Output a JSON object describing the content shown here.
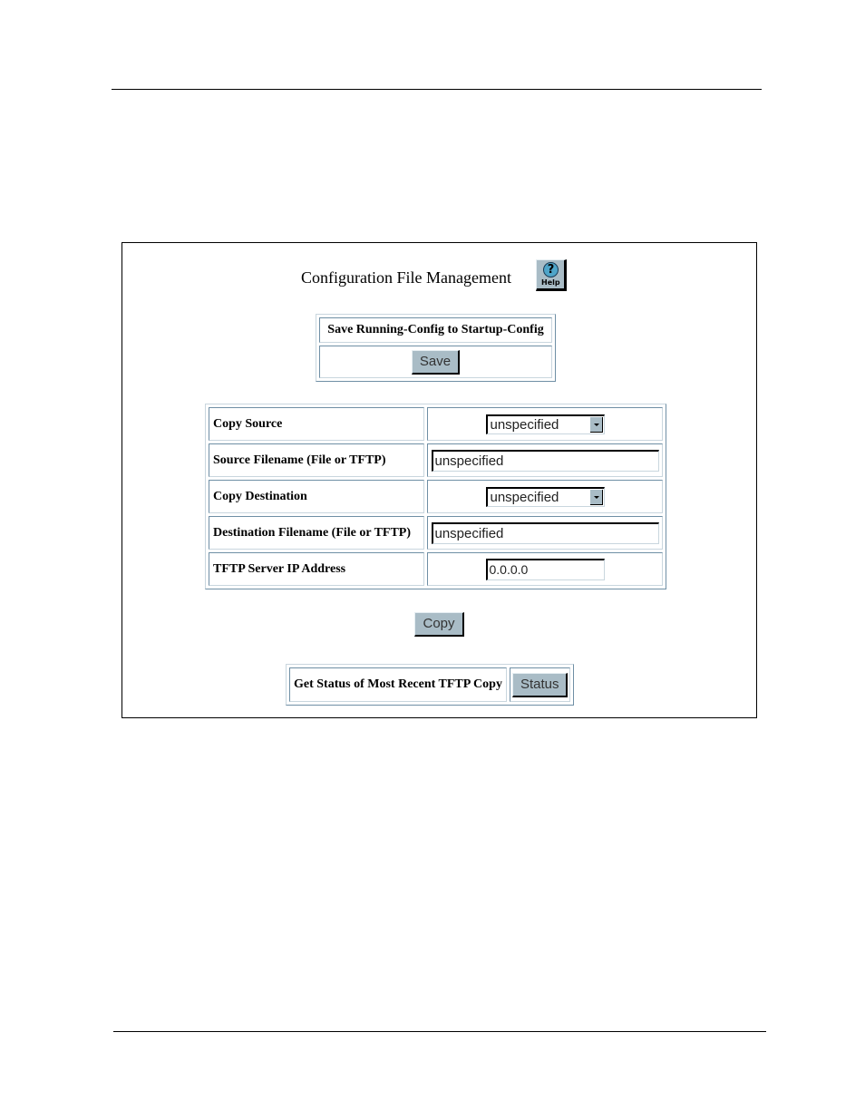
{
  "page": {
    "title": "Configuration File Management",
    "help_button": {
      "label": "Help",
      "icon": "help-question-icon"
    }
  },
  "save_section": {
    "header": "Save Running-Config to Startup-Config",
    "save_label": "Save"
  },
  "form": {
    "rows": [
      {
        "label": "Copy Source",
        "type": "select",
        "value": "unspecified"
      },
      {
        "label": "Source Filename (File or TFTP)",
        "type": "text",
        "value": "unspecified"
      },
      {
        "label": "Copy Destination",
        "type": "select",
        "value": "unspecified"
      },
      {
        "label": "Destination Filename (File or TFTP)",
        "type": "text",
        "value": "unspecified"
      },
      {
        "label": "TFTP Server IP Address",
        "type": "text",
        "value": "0.0.0.0"
      }
    ],
    "copy_label": "Copy"
  },
  "status_section": {
    "label": "Get Status of Most Recent TFTP Copy",
    "status_label": "Status"
  },
  "colors": {
    "button_face": "#a9bcc6",
    "table_border": "#6f8fa5"
  }
}
